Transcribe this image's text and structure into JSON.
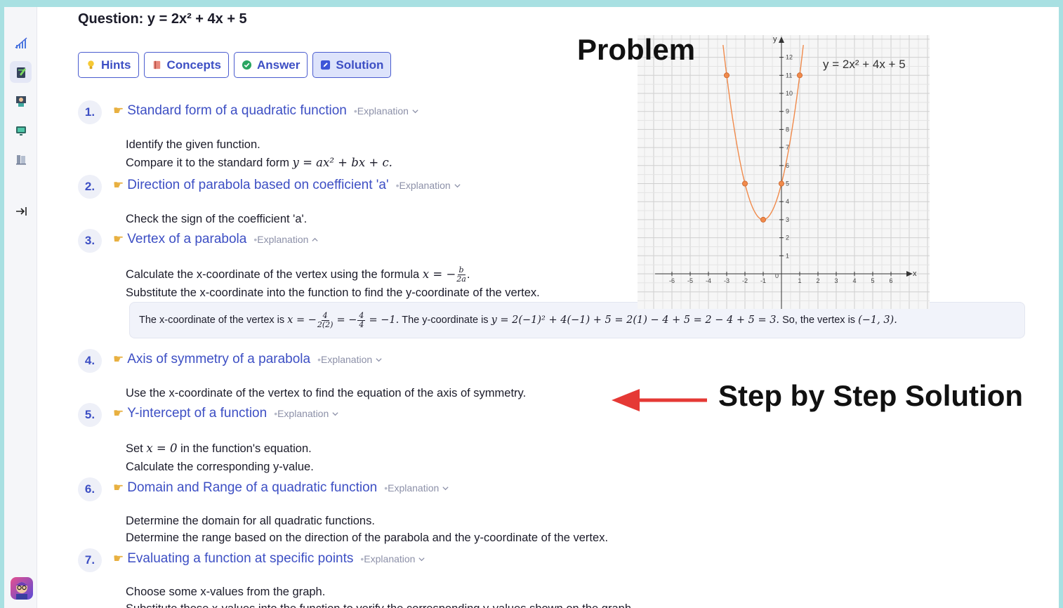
{
  "question": {
    "label": "Question:",
    "expression": "y = 2x² + 4x + 5"
  },
  "tabs": [
    {
      "label": "Hints",
      "icon": "lightbulb-icon"
    },
    {
      "label": "Concepts",
      "icon": "book-icon"
    },
    {
      "label": "Answer",
      "icon": "check-circle-icon"
    },
    {
      "label": "Solution",
      "icon": "edit-square-icon",
      "selected": true
    }
  ],
  "explanation_label": "Explanation",
  "steps": [
    {
      "number": "1.",
      "title": "Standard form of a quadratic function",
      "expanded": false,
      "lines": [
        "Identify the given function.",
        "Compare it to the standard form"
      ],
      "formula": "y = ax² + bx + c."
    },
    {
      "number": "2.",
      "title": "Direction of parabola based on coefficient 'a'",
      "expanded": false,
      "lines": [
        "Check the sign of the coefficient 'a'."
      ]
    },
    {
      "number": "3.",
      "title": "Vertex of a parabola",
      "expanded": true,
      "lines": [
        "Calculate the x-coordinate of the vertex using the formula",
        "Substitute the x-coordinate into the function to find the y-coordinate of the vertex."
      ],
      "formula_prefix": "x = −",
      "formula_num": "b",
      "formula_den": "2a",
      "explanation": {
        "p1": "The x-coordinate of the vertex is",
        "m1": "x = −",
        "f1_num": "4",
        "f1_den": "2(2)",
        "m2": "= −",
        "f2_num": "4",
        "f2_den": "4",
        "m3": "= −1.",
        "p2": "The y-coordinate is",
        "m4": "y = 2(−1)² + 4(−1) + 5 = 2(1) − 4 + 5 = 2 − 4 + 5 = 3.",
        "p3": "So, the vertex is",
        "m5": "(−1, 3)."
      }
    },
    {
      "number": "4.",
      "title": "Axis of symmetry of a parabola",
      "expanded": false,
      "lines": [
        "Use the x-coordinate of the vertex to find the equation of the axis of symmetry."
      ]
    },
    {
      "number": "5.",
      "title": "Y-intercept of a function",
      "expanded": false,
      "lines": [
        "Set",
        "in the function's equation.",
        "Calculate the corresponding y-value."
      ],
      "formula": "x = 0"
    },
    {
      "number": "6.",
      "title": "Domain and Range of a quadratic function",
      "expanded": false,
      "lines": [
        "Determine the domain for all quadratic functions.",
        "Determine the range based on the direction of the parabola and the y-coordinate of the vertex."
      ]
    },
    {
      "number": "7.",
      "title": "Evaluating a function at specific points",
      "expanded": false,
      "lines": [
        "Choose some x-values from the graph.",
        "Substitute these x-values into the function to verify the corresponding y-values shown on the graph."
      ]
    }
  ],
  "annotations": {
    "problem": "Problem",
    "solution": "Step by Step Solution",
    "arrow_color": "#e53935"
  },
  "colors": {
    "accent": "#3d4fc4",
    "curve": "#f08a4b",
    "point": "#f08a4b"
  },
  "sidebar": [
    {
      "icon": "chart-icon"
    },
    {
      "icon": "notebook-icon",
      "active": true
    },
    {
      "icon": "tutor-icon"
    },
    {
      "icon": "screen-icon"
    },
    {
      "icon": "library-icon"
    },
    {
      "icon": "collapse-sidebar-icon"
    },
    {
      "icon": "user-avatar"
    }
  ],
  "chart_data": {
    "type": "line",
    "title": "y = 2x² + 4x + 5",
    "xlabel": "x",
    "ylabel": "y",
    "xlim": [
      -7,
      7
    ],
    "ylim": [
      -1,
      13
    ],
    "x_ticks": [
      -6,
      -5,
      -4,
      -3,
      -2,
      -1,
      0,
      1,
      2,
      3,
      4,
      5,
      6
    ],
    "y_ticks": [
      1,
      2,
      3,
      4,
      5,
      6,
      7,
      8,
      9,
      10,
      11,
      12
    ],
    "grid": true,
    "series": [
      {
        "function": "2x^2+4x+5",
        "x_range": [
          -3.2,
          1.2
        ],
        "points": [
          [
            -3,
            11
          ],
          [
            -2,
            5
          ],
          [
            -1,
            3
          ],
          [
            0,
            5
          ],
          [
            1,
            11
          ]
        ]
      }
    ]
  }
}
